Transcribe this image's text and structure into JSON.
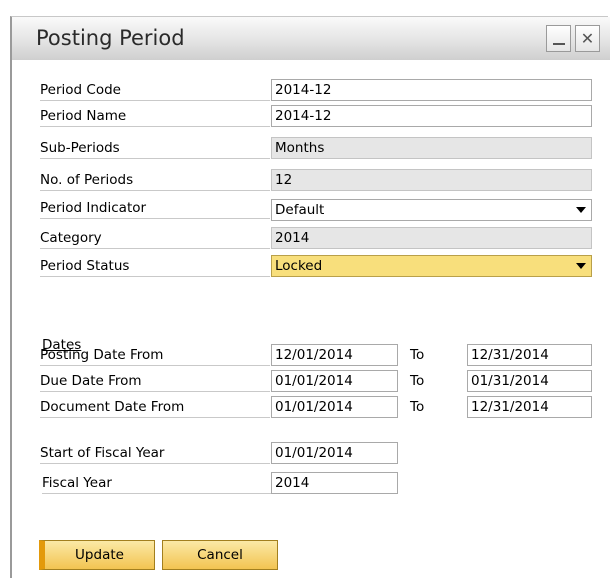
{
  "window": {
    "title": "Posting Period"
  },
  "form": {
    "period_code": {
      "label": "Period Code",
      "value": "2014-12"
    },
    "period_name": {
      "label": "Period Name",
      "value": "2014-12"
    },
    "sub_periods": {
      "label": "Sub-Periods",
      "value": "Months"
    },
    "no_of_periods": {
      "label": "No. of Periods",
      "value": "12"
    },
    "period_indicator": {
      "label": "Period Indicator",
      "value": "Default"
    },
    "category": {
      "label": "Category",
      "value": "2014"
    },
    "period_status": {
      "label": "Period Status",
      "value": "Locked"
    }
  },
  "dates": {
    "title": "Dates",
    "to_label": "To",
    "posting": {
      "label": "Posting Date From",
      "from": "12/01/2014",
      "to": "12/31/2014"
    },
    "due": {
      "label": "Due Date From",
      "from": "01/01/2014",
      "to": "01/31/2014"
    },
    "document": {
      "label": "Document Date From",
      "from": "01/01/2014",
      "to": "12/31/2014"
    }
  },
  "fiscal": {
    "start": {
      "label": "Start of Fiscal Year",
      "value": "01/01/2014"
    },
    "year": {
      "label": "Fiscal Year",
      "value": "2014"
    }
  },
  "buttons": {
    "update": "Update",
    "cancel": "Cancel"
  },
  "colors": {
    "status_field": "#f8df7c",
    "button_fill": "#f2c451",
    "readonly_field": "#e6e6e6"
  }
}
